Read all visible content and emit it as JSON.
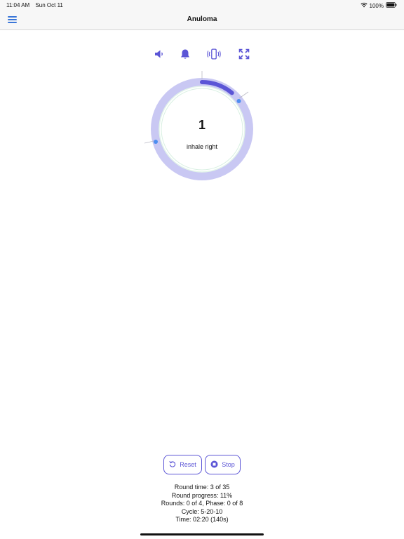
{
  "status_bar": {
    "time": "11:04 AM",
    "date": "Sun Oct 11",
    "battery": "100%"
  },
  "nav": {
    "title": "Anuloma"
  },
  "toolbar": {
    "icons": [
      "speaker-icon",
      "bell-icon",
      "vibrate-icon",
      "fullscreen-icon"
    ]
  },
  "timer": {
    "count": "1",
    "phase": "inhale right",
    "progress_fraction": 0.11
  },
  "buttons": {
    "reset_label": "Reset",
    "stop_label": "Stop"
  },
  "stats": {
    "round_time": "Round time: 3 of 35",
    "round_progress": "Round progress: 11%",
    "rounds_phase": "Rounds: 0 of 4, Phase: 0 of 8",
    "cycle": "Cycle: 5-20-10",
    "time": "Time: 02:20 (140s)"
  },
  "colors": {
    "accent": "#5b55d6",
    "ring": "#c9c8f3",
    "marker": "#4d8ef0",
    "link": "#3a76d8"
  }
}
